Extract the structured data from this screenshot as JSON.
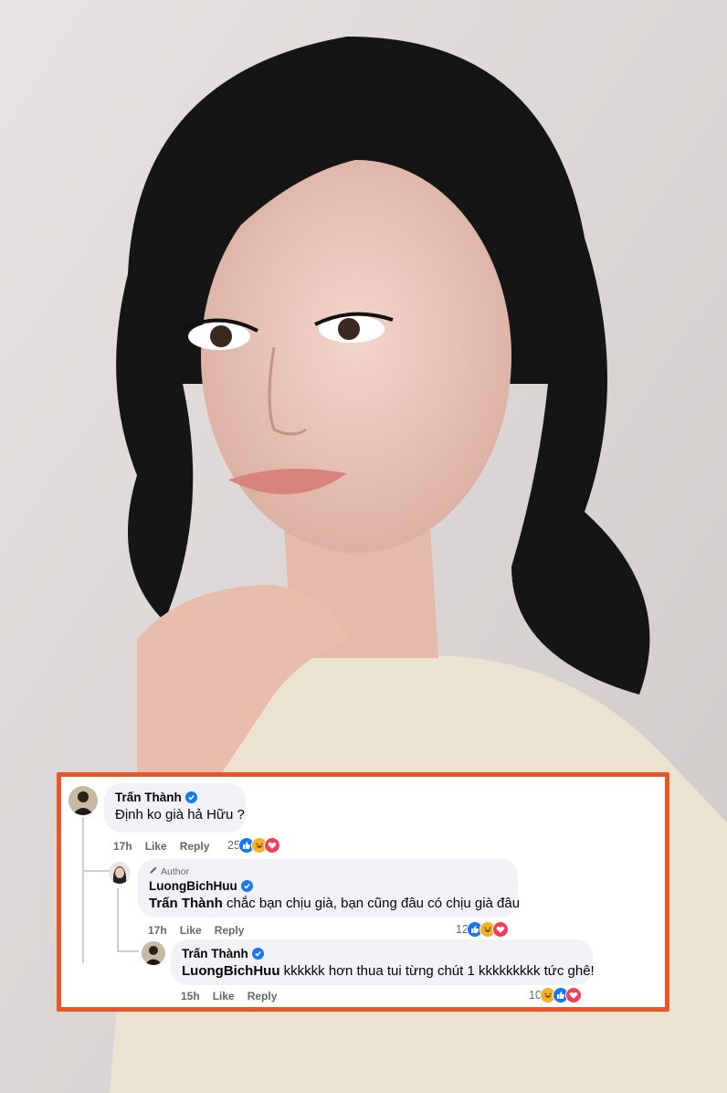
{
  "comments": [
    {
      "author": "Trấn Thành",
      "verified": true,
      "text": "Định ko già hả Hữu ?",
      "time": "17h",
      "like_label": "Like",
      "reply_label": "Reply",
      "reaction_count": "25",
      "reactions": [
        "like",
        "haha",
        "love"
      ]
    },
    {
      "author_tag": "Author",
      "author": "LuongBichHuu",
      "verified": true,
      "mention": "Trấn Thành",
      "text": "chắc bạn chịu già, bạn cũng đâu có chịu già đâu",
      "time": "17h",
      "like_label": "Like",
      "reply_label": "Reply",
      "reaction_count": "12",
      "reactions": [
        "like",
        "haha",
        "love"
      ]
    },
    {
      "author": "Trấn Thành",
      "verified": true,
      "mention": "LuongBichHuu",
      "text": "kkkkkk hơn thua tui từng chút 1 kkkkkkkkk tức ghê!",
      "time": "15h",
      "like_label": "Like",
      "reply_label": "Reply",
      "reaction_count": "10",
      "reactions": [
        "haha",
        "like",
        "love"
      ]
    }
  ],
  "colors": {
    "highlight_border": "#e8562a",
    "bubble": "#f0f2f5",
    "meta_text": "#65676b",
    "verified": "#1877f2"
  },
  "icons": [
    "verified-badge-icon",
    "pencil-icon",
    "like-reaction-icon",
    "haha-reaction-icon",
    "love-reaction-icon"
  ]
}
